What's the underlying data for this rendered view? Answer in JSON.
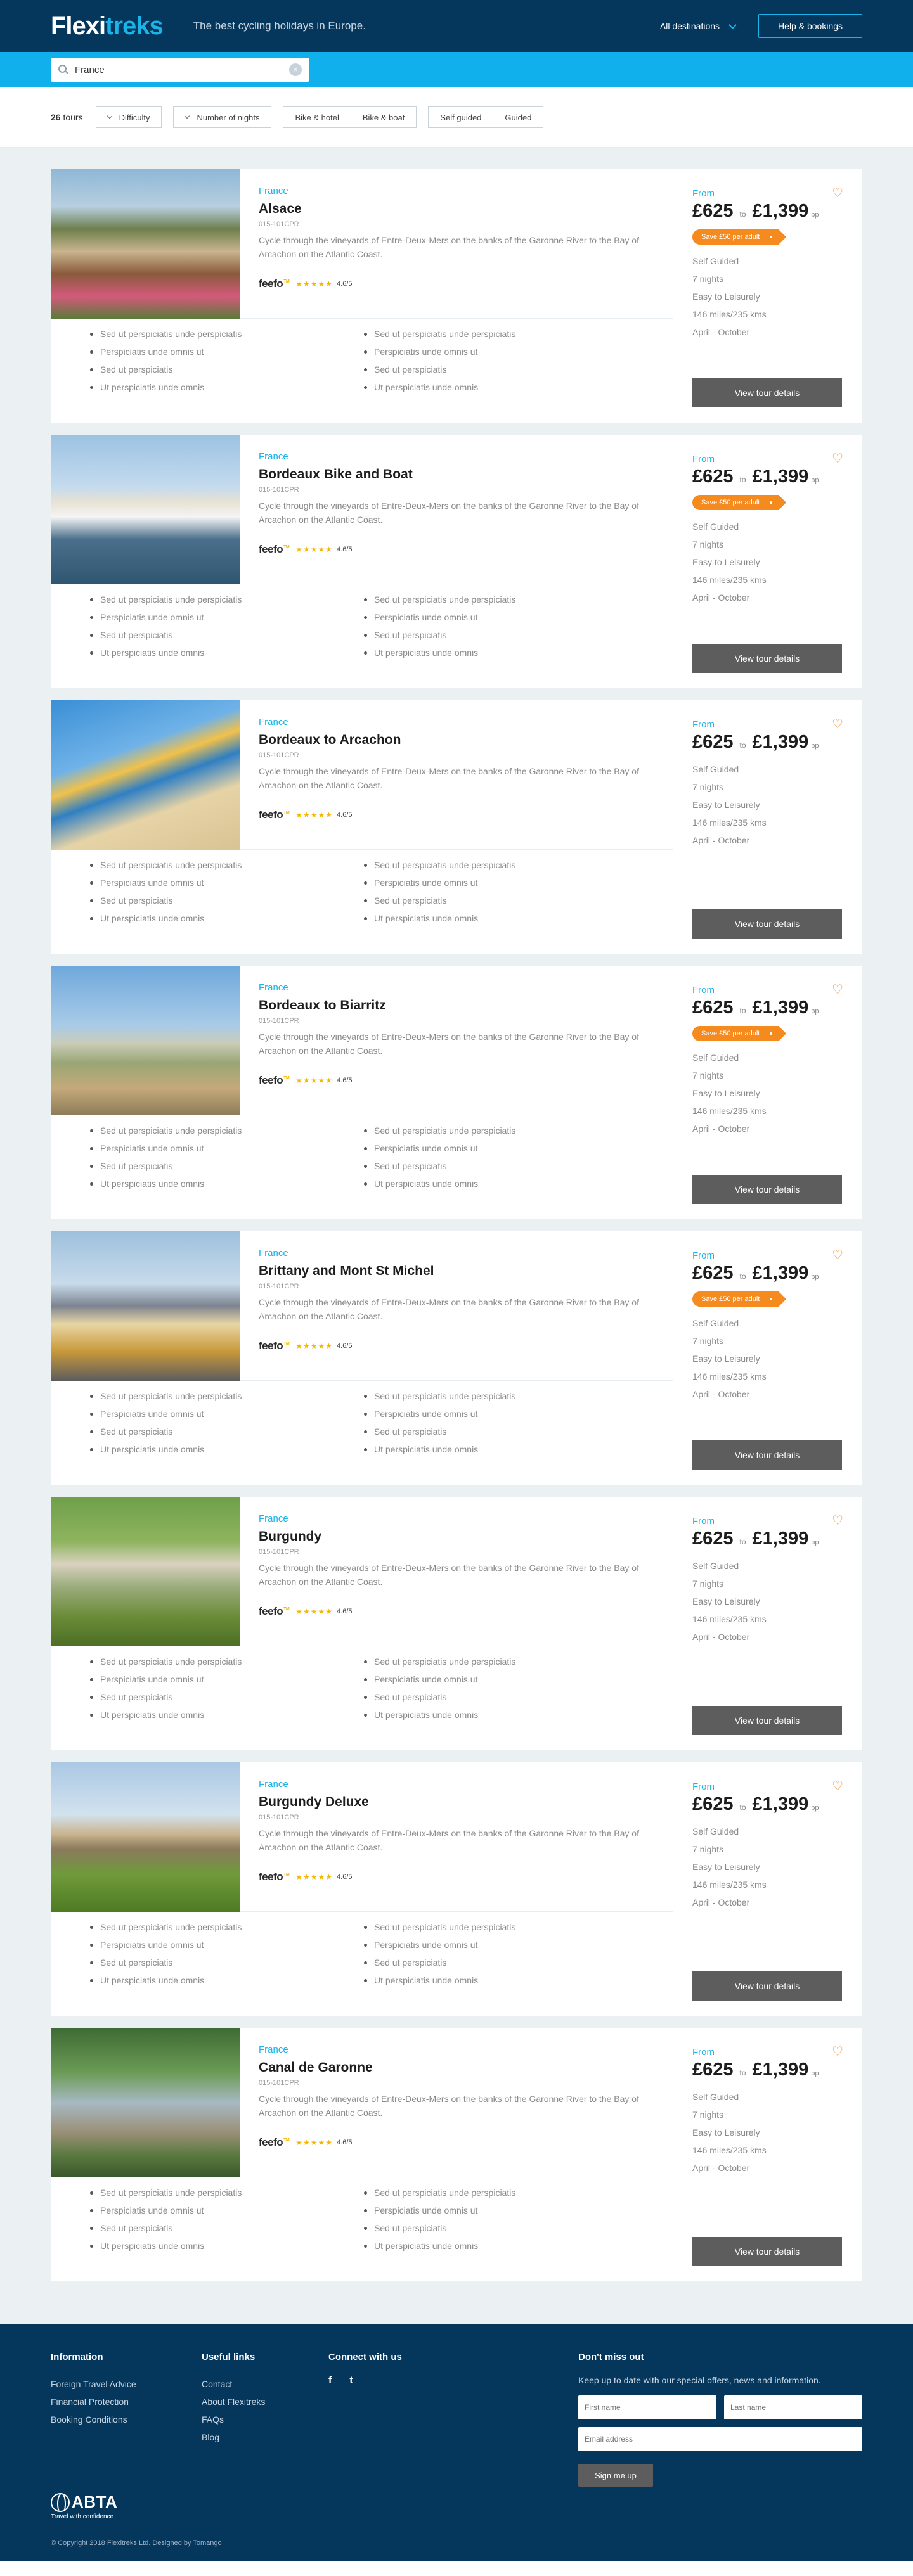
{
  "header": {
    "logo_part1": "Flexi",
    "logo_part2": "treks",
    "tagline": "The best cycling holidays in Europe.",
    "destinations_label": "All destinations",
    "help_label": "Help & bookings"
  },
  "search": {
    "value": "France",
    "clear_icon": "close-icon"
  },
  "filters": {
    "count": "26",
    "count_suffix": "tours",
    "difficulty": "Difficulty",
    "nights": "Number of nights",
    "bike_hotel": "Bike & hotel",
    "bike_boat": "Bike & boat",
    "self_guided": "Self guided",
    "guided": "Guided"
  },
  "common": {
    "from": "From",
    "to": "to",
    "pp": "pp",
    "view_label": "View tour details",
    "feefo": "feefo",
    "feefo_mark": "TM",
    "stars": "★★★★★",
    "score": "4.6/5",
    "code": "015-101CPR",
    "desc": "Cycle through the vineyards of Entre-Deux-Mers on the banks of the Garonne River to the Bay of Arcachon on the Atlantic Coast.",
    "features_left": [
      "Sed ut perspiciatis unde perspiciatis",
      "Perspiciatis unde omnis ut",
      "Sed ut perspiciatis",
      "Ut perspiciatis unde omnis"
    ],
    "features_right": [
      "Sed ut perspiciatis unde perspiciatis",
      "Perspiciatis unde omnis ut",
      "Sed ut perspiciatis",
      "Ut perspiciatis unde omnis"
    ]
  },
  "tours": [
    {
      "country": "France",
      "name": "Alsace",
      "price_low": "£625",
      "price_high": "£1,399",
      "save": "Save £50 per adult",
      "meta": [
        "Self Guided",
        "7 nights",
        "Easy to Leisurely",
        "146 miles/235 kms",
        "April - October"
      ]
    },
    {
      "country": "France",
      "name": "Bordeaux Bike and Boat",
      "price_low": "£625",
      "price_high": "£1,399",
      "save": "Save £50 per adult",
      "meta": [
        "Self Guided",
        "7 nights",
        "Easy to Leisurely",
        "146 miles/235 kms",
        "April - October"
      ]
    },
    {
      "country": "France",
      "name": "Bordeaux to Arcachon",
      "price_low": "£625",
      "price_high": "£1,399",
      "save": "",
      "meta": [
        "Self Guided",
        "7 nights",
        "Easy to Leisurely",
        "146 miles/235 kms",
        "April - October"
      ]
    },
    {
      "country": "France",
      "name": "Bordeaux to Biarritz",
      "price_low": "£625",
      "price_high": "£1,399",
      "save": "Save £50 per adult",
      "meta": [
        "Self Guided",
        "7 nights",
        "Easy to Leisurely",
        "146 miles/235 kms",
        "April - October"
      ]
    },
    {
      "country": "France",
      "name": "Brittany and Mont St Michel",
      "price_low": "£625",
      "price_high": "£1,399",
      "save": "Save £50 per adult",
      "meta": [
        "Self Guided",
        "7 nights",
        "Easy to Leisurely",
        "146 miles/235 kms",
        "April - October"
      ]
    },
    {
      "country": "France",
      "name": "Burgundy",
      "price_low": "£625",
      "price_high": "£1,399",
      "save": "",
      "meta": [
        "Self Guided",
        "7 nights",
        "Easy to Leisurely",
        "146 miles/235 kms",
        "April - October"
      ]
    },
    {
      "country": "France",
      "name": "Burgundy Deluxe",
      "price_low": "£625",
      "price_high": "£1,399",
      "save": "",
      "meta": [
        "Self Guided",
        "7 nights",
        "Easy to Leisurely",
        "146 miles/235 kms",
        "April - October"
      ]
    },
    {
      "country": "France",
      "name": "Canal de Garonne",
      "price_low": "£625",
      "price_high": "£1,399",
      "save": "",
      "meta": [
        "Self Guided",
        "7 nights",
        "Easy to Leisurely",
        "146 miles/235 kms",
        "April - October"
      ]
    }
  ],
  "footer": {
    "info_title": "Information",
    "info_links": [
      "Foreign Travel Advice",
      "Financial Protection",
      "Booking Conditions"
    ],
    "useful_title": "Useful links",
    "useful_links": [
      "Contact",
      "About Flexitreks",
      "FAQs",
      "Blog"
    ],
    "connect_title": "Connect with us",
    "facebook": "f",
    "twitter": "t",
    "news_title": "Don't miss out",
    "news_text": "Keep up to date with our special offers, news and information.",
    "first_name_ph": "First name",
    "last_name_ph": "Last name",
    "email_ph": "Email address",
    "signup_label": "Sign me up",
    "abta": "ABTA",
    "abta_sub": "Travel with confidence",
    "copyright": "© Copyright 2018 Flexitreks Ltd. Designed by Tomango"
  },
  "colors": {
    "navy": "#05365c",
    "cyan": "#1ab4e8",
    "orange": "#f58a1f",
    "button": "#5d5d5d"
  }
}
